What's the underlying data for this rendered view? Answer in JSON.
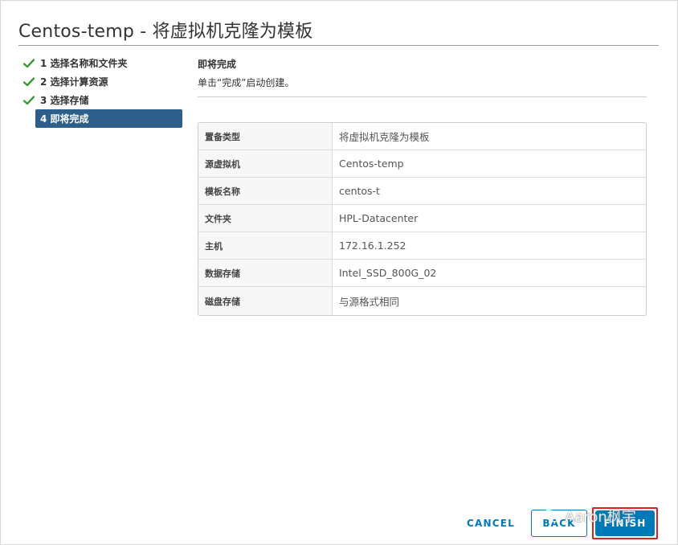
{
  "dialog": {
    "title": "Centos-temp - 将虚拟机克隆为模板"
  },
  "steps": [
    {
      "label": "1 选择名称和文件夹",
      "completed": true
    },
    {
      "label": "2 选择计算资源",
      "completed": true
    },
    {
      "label": "3 选择存储",
      "completed": true
    },
    {
      "label": "4 即将完成",
      "active": true
    }
  ],
  "content": {
    "title": "即将完成",
    "description": "单击“完成”启动创建。"
  },
  "summary": [
    {
      "label": "置备类型",
      "value": "将虚拟机克隆为模板"
    },
    {
      "label": "源虚拟机",
      "value": "Centos-temp"
    },
    {
      "label": "模板名称",
      "value": "centos-t"
    },
    {
      "label": "文件夹",
      "value": "HPL-Datacenter"
    },
    {
      "label": "主机",
      "value": "172.16.1.252"
    },
    {
      "label": "数据存储",
      "value": "Intel_SSD_800G_02"
    },
    {
      "label": "磁盘存储",
      "value": "与源格式相同"
    }
  ],
  "footer": {
    "cancel_label": "CANCEL",
    "back_label": "BACK",
    "finish_label": "FINISH"
  },
  "watermark": {
    "text": "Aaron枫宇"
  },
  "colors": {
    "accent": "#0079b8",
    "active_step": "#2e5f8a",
    "check": "#3c9a36",
    "highlight": "#e02020"
  }
}
